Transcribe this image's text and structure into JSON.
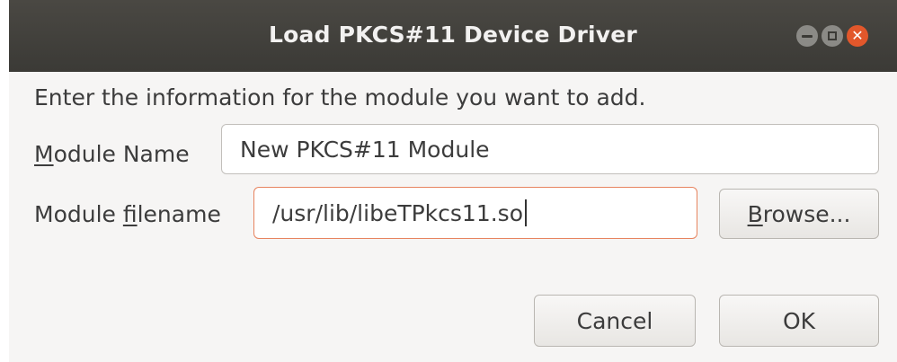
{
  "window": {
    "title": "Load PKCS#11 Device Driver"
  },
  "dialog": {
    "instruction": "Enter the information for the module you want to add.",
    "module_name_label_mnemonic": "M",
    "module_name_label_rest": "odule Name",
    "module_name_value": "New PKCS#11 Module",
    "module_filename_label_prefix": "Module ",
    "module_filename_label_mnemonic": "f",
    "module_filename_label_rest": "ilename",
    "module_filename_value": "/usr/lib/libeTPkcs11.so",
    "browse_mnemonic": "B",
    "browse_rest": "rowse...",
    "cancel_label": "Cancel",
    "ok_label": "OK"
  },
  "colors": {
    "titlebar": "#3b3a36",
    "close_button": "#e2572b",
    "focus_border": "#e7845f",
    "dialog_background": "#f6f5f4"
  },
  "icons": {
    "minimize": "minimize-icon",
    "maximize": "maximize-icon",
    "close": "close-icon"
  }
}
